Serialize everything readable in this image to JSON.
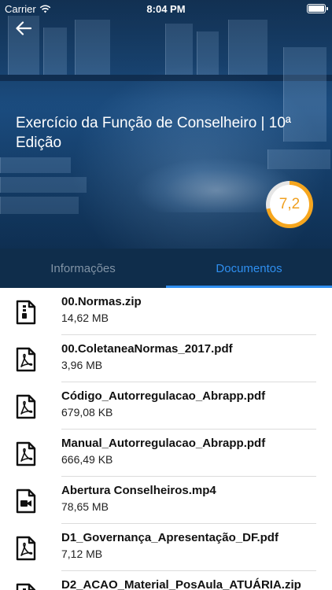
{
  "status_bar": {
    "carrier": "Carrier",
    "time": "8:04 PM"
  },
  "header": {
    "title": "Exercício da Função de Conselheiro | 10ª Edição",
    "score": "7,2",
    "score_fraction": 0.72
  },
  "tabs": [
    {
      "label": "Informações",
      "active": false
    },
    {
      "label": "Documentos",
      "active": true
    }
  ],
  "documents": [
    {
      "name": "00.Normas.zip",
      "size": "14,62 MB",
      "icon": "zip-file-icon"
    },
    {
      "name": "00.ColetaneaNormas_2017.pdf",
      "size": "3,96 MB",
      "icon": "pdf-file-icon"
    },
    {
      "name": "Código_Autorregulacao_Abrapp.pdf",
      "size": "679,08 KB",
      "icon": "pdf-file-icon"
    },
    {
      "name": "Manual_Autorregulacao_Abrapp.pdf",
      "size": "666,49 KB",
      "icon": "pdf-file-icon"
    },
    {
      "name": "Abertura Conselheiros.mp4",
      "size": "78,65 MB",
      "icon": "video-file-icon"
    },
    {
      "name": "D1_Governança_Apresentação_DF.pdf",
      "size": "7,12 MB",
      "icon": "pdf-file-icon"
    },
    {
      "name": "D2_ACAO_Material_PosAula_ATUÁRIA.zip",
      "size": "",
      "icon": "zip-file-icon"
    }
  ],
  "colors": {
    "accent": "#2f8ff0",
    "tab_bar": "#0f2d4b",
    "score_ring": "#f6a61e"
  }
}
